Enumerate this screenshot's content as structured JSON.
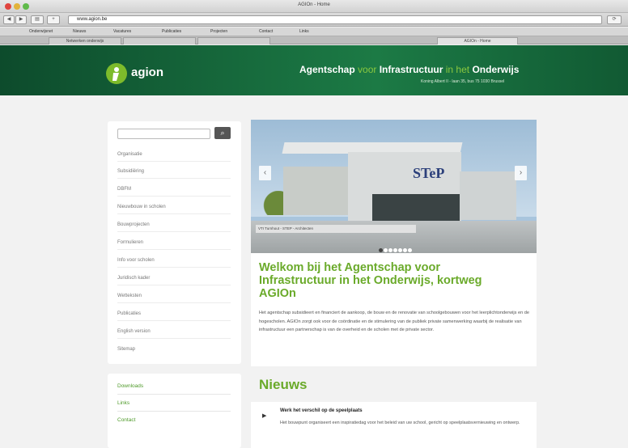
{
  "browser": {
    "window_title": "AGIOn - Home",
    "url": "www.agion.be",
    "bookmarks": [
      "Onderwijsnet",
      "Nieuws",
      "Vacatures",
      "Publicaties",
      "Projecten",
      "Contact",
      "Links"
    ],
    "tabs": [
      "Netwerken onderwijs",
      "",
      "",
      "AGIOn - Home"
    ]
  },
  "header": {
    "logo_text": "agion",
    "title_part1": "Agentschap",
    "title_voor": "voor",
    "title_part2": "Infrastructuur",
    "title_in_het": "in het",
    "title_part3": "Onderwijs",
    "address": "Koning Albert II - laan 35, bus 75 1030 Brussel"
  },
  "search": {
    "placeholder": "",
    "button_icon": "search-icon"
  },
  "sidebar": {
    "items": [
      "Organisatie",
      "Subsidiëring",
      "DBFM",
      "Nieuwbouw in scholen",
      "Bouwprojecten",
      "Formulieren",
      "Info voor scholen",
      "Juridisch kader",
      "Wetteksten",
      "Publicaties",
      "English version",
      "Sitemap"
    ]
  },
  "sidebar2": {
    "items": [
      "Downloads",
      "Links",
      "Contact"
    ]
  },
  "carousel": {
    "caption": "VTI Turnhout - STEP - Architecten",
    "building_sign": "STeP",
    "slide_count": 7,
    "active_slide": 1
  },
  "welcome": {
    "title": "Welkom bij het Agentschap voor Infrastructuur in het Onderwijs, kortweg AGIOn",
    "body": "Het agentschap subsidieert en financiert de aankoop, de bouw en de renovatie van schoolgebouwen voor het leerplichtonderwijs en de hogescholen. AGIOn zorgt ook voor de coördinatie en de stimulering van de publiek private samenwerking waarbij de realisatie van infrastructuur een partnerschap is van de overheid en de scholen met de private sector."
  },
  "news": {
    "heading": "Nieuws",
    "items": [
      {
        "title": "Werk het verschil op de speelplaats",
        "body": "Het bouwpunt organiseert een inspiratiedag voor het beleid van uw school, gericht op speelplaatsvernieuwing en ontwerp."
      }
    ]
  },
  "colors": {
    "brand_green": "#6aaa2a",
    "header_green": "#176b3d",
    "logo_green": "#7dbb2b"
  }
}
